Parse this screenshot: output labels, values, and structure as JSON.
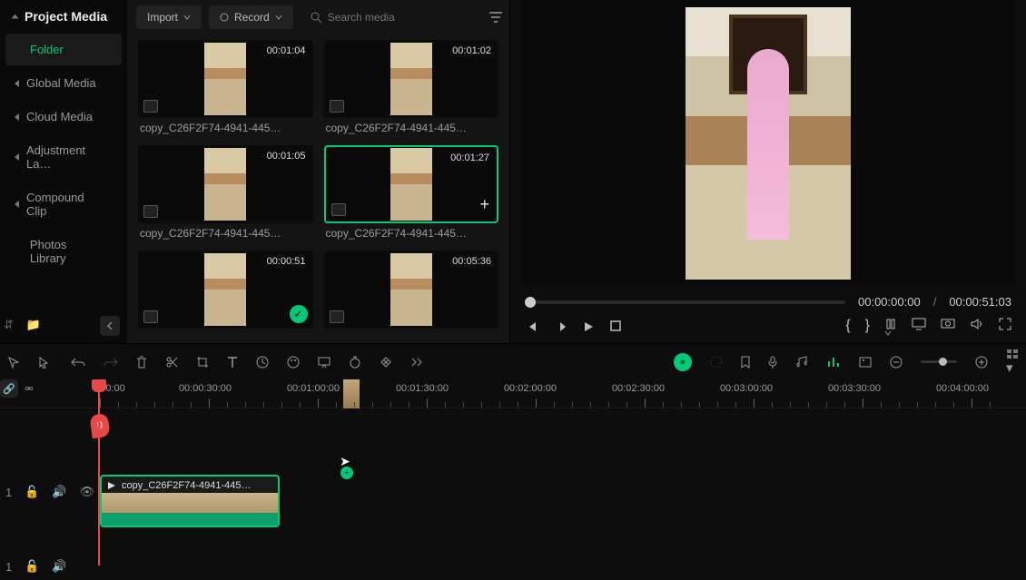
{
  "sidebar": {
    "title": "Project Media",
    "items": [
      {
        "label": "Folder",
        "selected": true,
        "expandable": false
      },
      {
        "label": "Global Media",
        "selected": false,
        "expandable": true
      },
      {
        "label": "Cloud Media",
        "selected": false,
        "expandable": true
      },
      {
        "label": "Adjustment La…",
        "selected": false,
        "expandable": true
      },
      {
        "label": "Compound Clip",
        "selected": false,
        "expandable": true
      },
      {
        "label": "Photos Library",
        "selected": false,
        "expandable": false
      }
    ],
    "collapse_icon": "chevron-left"
  },
  "media_toolbar": {
    "import_label": "Import",
    "record_label": "Record",
    "search_placeholder": "Search media"
  },
  "clips": [
    {
      "duration": "00:01:04",
      "name": "copy_C26F2F74-4941-445…",
      "selected": false,
      "checked": false
    },
    {
      "duration": "00:01:02",
      "name": "copy_C26F2F74-4941-445…",
      "selected": false,
      "checked": false
    },
    {
      "duration": "00:01:05",
      "name": "copy_C26F2F74-4941-445…",
      "selected": false,
      "checked": false
    },
    {
      "duration": "00:01:27",
      "name": "copy_C26F2F74-4941-445…",
      "selected": true,
      "checked": false,
      "showAdd": true
    },
    {
      "duration": "00:00:51",
      "name": "",
      "selected": false,
      "checked": true
    },
    {
      "duration": "00:05:36",
      "name": "",
      "selected": false,
      "checked": false
    }
  ],
  "transport": {
    "current_tc": "00:00:00:00",
    "sep": "/",
    "total_tc": "00:00:51:03"
  },
  "ruler": [
    {
      "label": "00:00",
      "pos": 124
    },
    {
      "label": "00:00:30:00",
      "pos": 226
    },
    {
      "label": "00:01:00:00",
      "pos": 345
    },
    {
      "label": "00:01:30:00",
      "pos": 465
    },
    {
      "label": "00:02:00:00",
      "pos": 584
    },
    {
      "label": "00:02:30:00",
      "pos": 703
    },
    {
      "label": "00:03:00:00",
      "pos": 822
    },
    {
      "label": "00:03:30:00",
      "pos": 941
    },
    {
      "label": "00:04:00:00",
      "pos": 1060
    }
  ],
  "timeline_clip": {
    "label": "copy_C26F2F74-4941-445…"
  },
  "track_number": "1",
  "playhead_badge": "0"
}
